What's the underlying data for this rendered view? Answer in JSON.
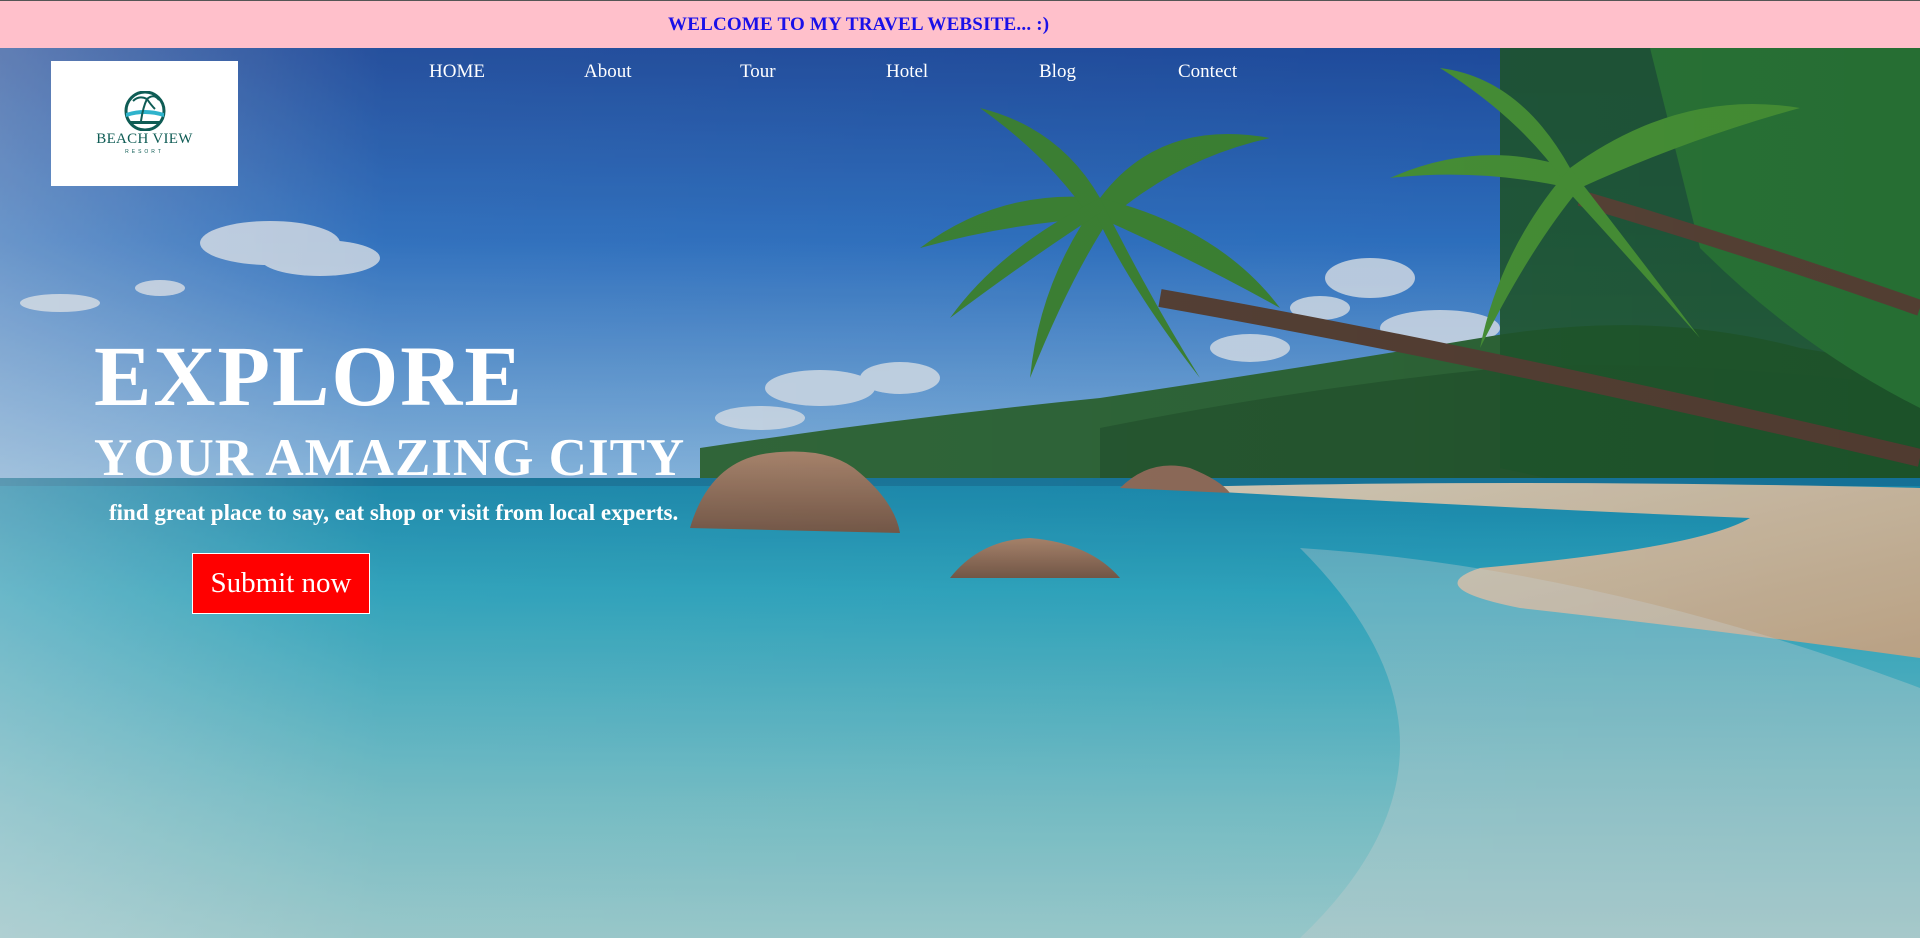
{
  "banner": {
    "text": "WELCOME TO MY TRAVEL WEBSITE... :)"
  },
  "logo": {
    "title": "BEACH VIEW",
    "subtitle": "RESORT"
  },
  "nav": {
    "items": [
      {
        "label": "HOME"
      },
      {
        "label": "About"
      },
      {
        "label": "Tour"
      },
      {
        "label": "Hotel"
      },
      {
        "label": "Blog"
      },
      {
        "label": "Contect"
      }
    ]
  },
  "hero": {
    "headline": "EXPLORE",
    "subheadline": "YOUR AMAZING CITY",
    "tagline": "find great place to say, eat shop or visit from local experts.",
    "cta_label": "Submit now"
  },
  "colors": {
    "banner_bg": "#ffc0cb",
    "banner_text": "#1a10e8",
    "cta_bg": "#ff0000",
    "logo_teal": "#0f5c55"
  }
}
